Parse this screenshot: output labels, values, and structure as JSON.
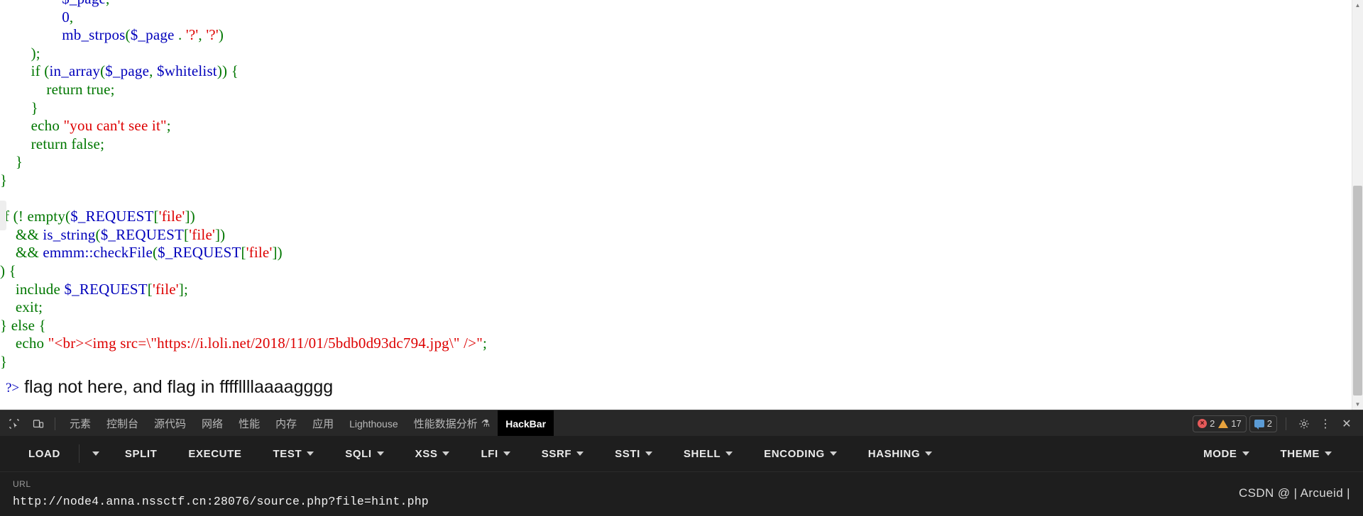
{
  "page": {
    "code_lines": [
      [
        {
          "t": "                ",
          "c": "plain"
        },
        {
          "t": "$_page",
          "c": "var"
        },
        {
          "t": ",",
          "c": "punct"
        }
      ],
      [
        {
          "t": "                ",
          "c": "plain"
        },
        {
          "t": "0",
          "c": "num"
        },
        {
          "t": ",",
          "c": "punct"
        }
      ],
      [
        {
          "t": "                ",
          "c": "plain"
        },
        {
          "t": "mb_strpos",
          "c": "fn"
        },
        {
          "t": "(",
          "c": "punct"
        },
        {
          "t": "$_page",
          "c": "var"
        },
        {
          "t": " . ",
          "c": "punct"
        },
        {
          "t": "'?'",
          "c": "str"
        },
        {
          "t": ", ",
          "c": "punct"
        },
        {
          "t": "'?'",
          "c": "str"
        },
        {
          "t": ")",
          "c": "punct"
        }
      ],
      [
        {
          "t": "        ",
          "c": "plain"
        },
        {
          "t": ");",
          "c": "punct"
        }
      ],
      [
        {
          "t": "        ",
          "c": "plain"
        },
        {
          "t": "if",
          "c": "kw"
        },
        {
          "t": " (",
          "c": "punct"
        },
        {
          "t": "in_array",
          "c": "fn"
        },
        {
          "t": "(",
          "c": "punct"
        },
        {
          "t": "$_page",
          "c": "var"
        },
        {
          "t": ", ",
          "c": "punct"
        },
        {
          "t": "$whitelist",
          "c": "var"
        },
        {
          "t": ")) {",
          "c": "punct"
        }
      ],
      [
        {
          "t": "            ",
          "c": "plain"
        },
        {
          "t": "return",
          "c": "kw"
        },
        {
          "t": " ",
          "c": "plain"
        },
        {
          "t": "true",
          "c": "kw"
        },
        {
          "t": ";",
          "c": "punct"
        }
      ],
      [
        {
          "t": "        ",
          "c": "plain"
        },
        {
          "t": "}",
          "c": "punct"
        }
      ],
      [
        {
          "t": "        ",
          "c": "plain"
        },
        {
          "t": "echo",
          "c": "kw"
        },
        {
          "t": " ",
          "c": "plain"
        },
        {
          "t": "\"you can't see it\"",
          "c": "str"
        },
        {
          "t": ";",
          "c": "punct"
        }
      ],
      [
        {
          "t": "        ",
          "c": "plain"
        },
        {
          "t": "return",
          "c": "kw"
        },
        {
          "t": " ",
          "c": "plain"
        },
        {
          "t": "false",
          "c": "kw"
        },
        {
          "t": ";",
          "c": "punct"
        }
      ],
      [
        {
          "t": "    ",
          "c": "plain"
        },
        {
          "t": "}",
          "c": "punct"
        }
      ],
      [
        {
          "t": "",
          "c": "plain"
        },
        {
          "t": "}",
          "c": "punct"
        }
      ],
      [
        {
          "t": "",
          "c": "plain"
        }
      ],
      [
        {
          "t": "",
          "c": "plain"
        },
        {
          "t": "if",
          "c": "kw"
        },
        {
          "t": " (! ",
          "c": "punct"
        },
        {
          "t": "empty",
          "c": "kw"
        },
        {
          "t": "(",
          "c": "punct"
        },
        {
          "t": "$_REQUEST",
          "c": "var"
        },
        {
          "t": "[",
          "c": "punct"
        },
        {
          "t": "'file'",
          "c": "str"
        },
        {
          "t": "])",
          "c": "punct"
        }
      ],
      [
        {
          "t": "    ",
          "c": "plain"
        },
        {
          "t": "&& ",
          "c": "punct"
        },
        {
          "t": "is_string",
          "c": "fn"
        },
        {
          "t": "(",
          "c": "punct"
        },
        {
          "t": "$_REQUEST",
          "c": "var"
        },
        {
          "t": "[",
          "c": "punct"
        },
        {
          "t": "'file'",
          "c": "str"
        },
        {
          "t": "])",
          "c": "punct"
        }
      ],
      [
        {
          "t": "    ",
          "c": "plain"
        },
        {
          "t": "&& ",
          "c": "punct"
        },
        {
          "t": "emmm::checkFile",
          "c": "fn"
        },
        {
          "t": "(",
          "c": "punct"
        },
        {
          "t": "$_REQUEST",
          "c": "var"
        },
        {
          "t": "[",
          "c": "punct"
        },
        {
          "t": "'file'",
          "c": "str"
        },
        {
          "t": "])",
          "c": "punct"
        }
      ],
      [
        {
          "t": "",
          "c": "plain"
        },
        {
          "t": ") {",
          "c": "punct"
        }
      ],
      [
        {
          "t": "    ",
          "c": "plain"
        },
        {
          "t": "include",
          "c": "kw"
        },
        {
          "t": " ",
          "c": "plain"
        },
        {
          "t": "$_REQUEST",
          "c": "var"
        },
        {
          "t": "[",
          "c": "punct"
        },
        {
          "t": "'file'",
          "c": "str"
        },
        {
          "t": "];",
          "c": "punct"
        }
      ],
      [
        {
          "t": "    ",
          "c": "plain"
        },
        {
          "t": "exit",
          "c": "kw"
        },
        {
          "t": ";",
          "c": "punct"
        }
      ],
      [
        {
          "t": "",
          "c": "plain"
        },
        {
          "t": "} ",
          "c": "punct"
        },
        {
          "t": "else",
          "c": "kw"
        },
        {
          "t": " {",
          "c": "punct"
        }
      ],
      [
        {
          "t": "    ",
          "c": "plain"
        },
        {
          "t": "echo",
          "c": "kw"
        },
        {
          "t": " ",
          "c": "plain"
        },
        {
          "t": "\"<br><img src=\\\"https://i.loli.net/2018/11/01/5bdb0d93dc794.jpg\\\" />\"",
          "c": "str"
        },
        {
          "t": ";",
          "c": "punct"
        }
      ],
      [
        {
          "t": "",
          "c": "plain"
        },
        {
          "t": "}",
          "c": "punct"
        }
      ]
    ],
    "php_close_tag": "?>",
    "hint_text": "flag not here, and flag in ffffllllaaaagggg"
  },
  "devtools": {
    "inspect_icon": "inspect-element-icon",
    "device_icon": "device-toolbar-icon",
    "tabs": [
      {
        "label": "元素",
        "active": false
      },
      {
        "label": "控制台",
        "active": false
      },
      {
        "label": "源代码",
        "active": false
      },
      {
        "label": "网络",
        "active": false
      },
      {
        "label": "性能",
        "active": false
      },
      {
        "label": "内存",
        "active": false
      },
      {
        "label": "应用",
        "active": false
      },
      {
        "label": "Lighthouse",
        "active": false
      },
      {
        "label": "性能数据分析",
        "active": false,
        "flask": "⚗"
      },
      {
        "label": "HackBar",
        "active": true
      }
    ],
    "counters": {
      "errors": "2",
      "warnings": "17",
      "messages": "2"
    },
    "settings_icon": "gear-icon",
    "more_icon": "kebab-menu-icon",
    "close_icon": "close-icon"
  },
  "hackbar": {
    "left_items": [
      {
        "label": "LOAD",
        "caret": false
      },
      {
        "label": "SPLIT",
        "caret": false
      },
      {
        "label": "EXECUTE",
        "caret": false
      },
      {
        "label": "TEST",
        "caret": true
      },
      {
        "label": "SQLI",
        "caret": true
      },
      {
        "label": "XSS",
        "caret": true
      },
      {
        "label": "LFI",
        "caret": true
      },
      {
        "label": "SSRF",
        "caret": true
      },
      {
        "label": "SSTI",
        "caret": true
      },
      {
        "label": "SHELL",
        "caret": true
      },
      {
        "label": "ENCODING",
        "caret": true
      },
      {
        "label": "HASHING",
        "caret": true
      }
    ],
    "right_items": [
      {
        "label": "MODE",
        "caret": true
      },
      {
        "label": "THEME",
        "caret": true
      }
    ],
    "url_label": "URL",
    "url_value": "http://node4.anna.nssctf.cn:28076/source.php?file=hint.php"
  },
  "watermark": "CSDN @ | Arcueid |",
  "colors": {
    "keyword": "#007700",
    "variable": "#0000bb",
    "string": "#dd0000",
    "devtools_bg": "#282828",
    "hackbar_bg": "#1e1e1e"
  }
}
